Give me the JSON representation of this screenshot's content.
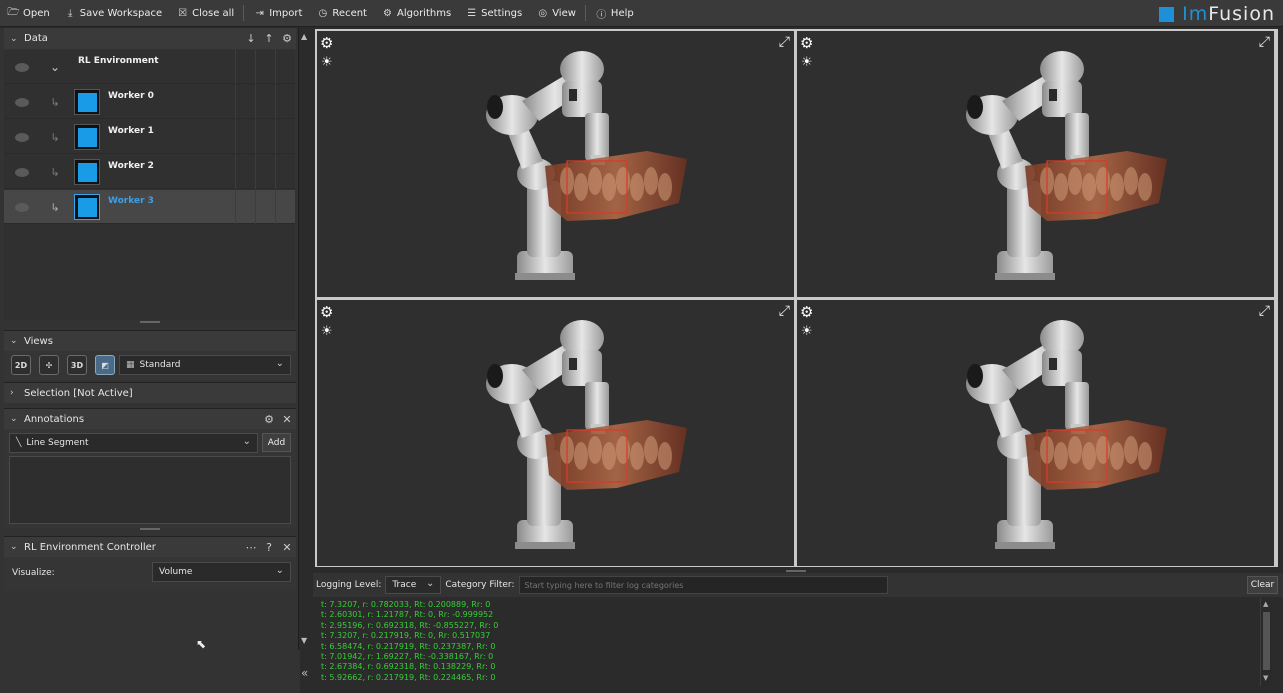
{
  "menubar": {
    "items": [
      {
        "label": "Open",
        "icon": "folder-open-icon"
      },
      {
        "label": "Save Workspace",
        "icon": "download-icon"
      },
      {
        "label": "Close all",
        "icon": "close-box-icon"
      },
      {
        "label": "Import",
        "icon": "import-icon"
      },
      {
        "label": "Recent",
        "icon": "clock-icon"
      },
      {
        "label": "Algorithms",
        "icon": "cogs-icon"
      },
      {
        "label": "Settings",
        "icon": "sliders-icon"
      },
      {
        "label": "View",
        "icon": "eye-icon"
      },
      {
        "label": "Help",
        "icon": "question-icon"
      }
    ],
    "logo_prefix": "Im",
    "logo_suffix": "Fusion"
  },
  "data_panel": {
    "title": "Data",
    "root": "RL Environment",
    "items": [
      {
        "label": "Worker 0",
        "selected": false
      },
      {
        "label": "Worker 1",
        "selected": false
      },
      {
        "label": "Worker 2",
        "selected": false
      },
      {
        "label": "Worker 3",
        "selected": true
      }
    ]
  },
  "views_panel": {
    "title": "Views",
    "btn_2d": "2D",
    "btn_3d": "3D",
    "layout": "Standard"
  },
  "selection_panel": {
    "title": "Selection [Not Active]"
  },
  "annotations_panel": {
    "title": "Annotations",
    "type": "Line Segment",
    "add_label": "Add"
  },
  "rl_panel": {
    "title": "RL Environment Controller",
    "visualize_label": "Visualize:",
    "visualize_value": "Volume"
  },
  "log": {
    "level_label": "Logging Level:",
    "level_value": "Trace",
    "filter_label": "Category Filter:",
    "filter_placeholder": "Start typing here to filter log categories",
    "clear_label": "Clear",
    "lines": [
      "t: 7.3207, r: 0.782033, Rt: 0.200889, Rr: 0",
      "t: 2.60301, r: 1.21787, Rt: 0, Rr: -0.999952",
      "t: 2.95196, r: 0.692318, Rt: -0.855227, Rr: 0",
      "t: 7.3207, r: 0.217919, Rt: 0, Rr: 0.517037",
      "t: 6.58474, r: 0.217919, Rt: 0.237387, Rr: 0",
      "t: 7.01942, r: 1.69227, Rt: -0.338167, Rr: 0",
      "t: 2.67384, r: 0.692318, Rt: 0.138229, Rr: 0",
      "t: 5.92662, r: 0.217919, Rt: 0.224465, Rr: 0"
    ]
  },
  "colors": {
    "accent": "#1e90d8",
    "log_text": "#34d034",
    "worker_thumb": "#1a9be8"
  }
}
